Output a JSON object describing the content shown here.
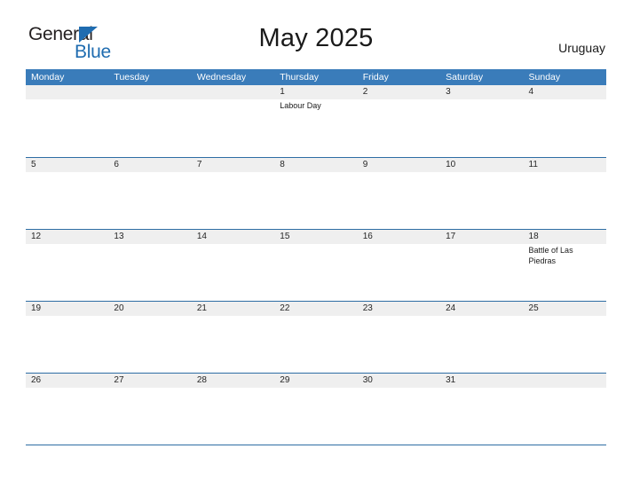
{
  "logo": {
    "line1": "General",
    "line2": "Blue",
    "triangle_icon": "logo-triangle-icon",
    "color_dark": "#231f20",
    "color_blue": "#1f6cb0"
  },
  "header": {
    "title": "May 2025",
    "country": "Uruguay"
  },
  "colors": {
    "header_blue": "#3a7cba",
    "rule_blue": "#2e6da4",
    "band_gray": "#efefef",
    "text": "#1a1a1a"
  },
  "calendar": {
    "weekdays": [
      "Monday",
      "Tuesday",
      "Wednesday",
      "Thursday",
      "Friday",
      "Saturday",
      "Sunday"
    ],
    "weeks": [
      [
        {
          "day": "",
          "events": []
        },
        {
          "day": "",
          "events": []
        },
        {
          "day": "",
          "events": []
        },
        {
          "day": "1",
          "events": [
            "Labour Day"
          ]
        },
        {
          "day": "2",
          "events": []
        },
        {
          "day": "3",
          "events": []
        },
        {
          "day": "4",
          "events": []
        }
      ],
      [
        {
          "day": "5",
          "events": []
        },
        {
          "day": "6",
          "events": []
        },
        {
          "day": "7",
          "events": []
        },
        {
          "day": "8",
          "events": []
        },
        {
          "day": "9",
          "events": []
        },
        {
          "day": "10",
          "events": []
        },
        {
          "day": "11",
          "events": []
        }
      ],
      [
        {
          "day": "12",
          "events": []
        },
        {
          "day": "13",
          "events": []
        },
        {
          "day": "14",
          "events": []
        },
        {
          "day": "15",
          "events": []
        },
        {
          "day": "16",
          "events": []
        },
        {
          "day": "17",
          "events": []
        },
        {
          "day": "18",
          "events": [
            "Battle of Las Piedras"
          ]
        }
      ],
      [
        {
          "day": "19",
          "events": []
        },
        {
          "day": "20",
          "events": []
        },
        {
          "day": "21",
          "events": []
        },
        {
          "day": "22",
          "events": []
        },
        {
          "day": "23",
          "events": []
        },
        {
          "day": "24",
          "events": []
        },
        {
          "day": "25",
          "events": []
        }
      ],
      [
        {
          "day": "26",
          "events": []
        },
        {
          "day": "27",
          "events": []
        },
        {
          "day": "28",
          "events": []
        },
        {
          "day": "29",
          "events": []
        },
        {
          "day": "30",
          "events": []
        },
        {
          "day": "31",
          "events": []
        },
        {
          "day": "",
          "events": []
        }
      ]
    ]
  }
}
